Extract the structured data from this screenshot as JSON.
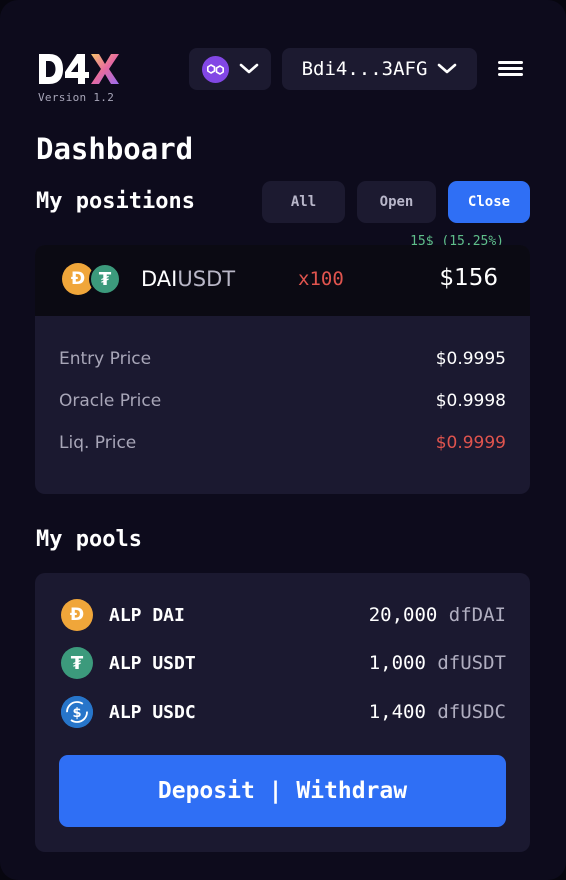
{
  "header": {
    "logo_text": "D4X",
    "version": "Version 1.2",
    "chain_icon": "polygon-icon",
    "wallet_address": "Bdi4...3AFG"
  },
  "page_title": "Dashboard",
  "positions": {
    "section_title": "My positions",
    "filters": [
      "All",
      "Open",
      "Close"
    ],
    "active_filter": "Close",
    "items": [
      {
        "pnl": "15$ (15,25%)",
        "pair_base": "DAI",
        "pair_quote": "USDT",
        "leverage": "x100",
        "value": "$156",
        "details": [
          {
            "label": "Entry Price",
            "value": "$0.9995"
          },
          {
            "label": "Oracle Price",
            "value": "$0.9998"
          },
          {
            "label": "Liq. Price",
            "value": "$0.9999"
          }
        ]
      }
    ]
  },
  "pools": {
    "section_title": "My pools",
    "items": [
      {
        "name": "ALP DAI",
        "amount": "20,000",
        "unit": "dfDAI",
        "icon": "dai-icon"
      },
      {
        "name": "ALP USDT",
        "amount": "1,000",
        "unit": "dfUSDT",
        "icon": "usdt-icon"
      },
      {
        "name": "ALP USDC",
        "amount": "1,400",
        "unit": "dfUSDC",
        "icon": "usdc-icon"
      }
    ],
    "action_label": "Deposit | Withdraw"
  },
  "colors": {
    "background": "#0d0b1c",
    "card": "#1b1930",
    "accent": "#2f6ff5",
    "negative": "#e0544e",
    "positive": "#5fbf8a",
    "dai": "#f0a63a",
    "usdt": "#3c9a7c",
    "usdc": "#2775ca",
    "polygon": "#8247e5"
  }
}
